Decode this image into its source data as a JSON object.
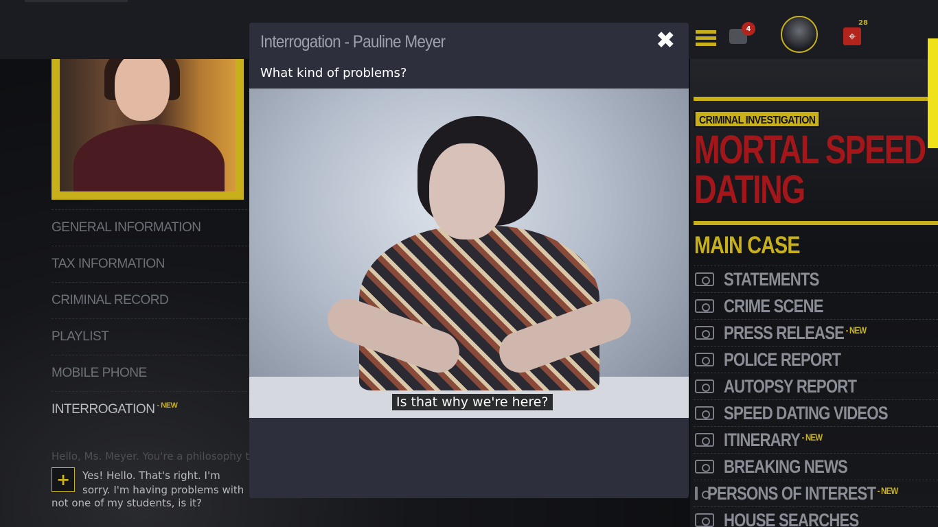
{
  "profile_menu": [
    {
      "label": "GENERAL INFORMATION",
      "new": ""
    },
    {
      "label": "TAX INFORMATION",
      "new": ""
    },
    {
      "label": "CRIMINAL RECORD",
      "new": ""
    },
    {
      "label": "PLAYLIST",
      "new": ""
    },
    {
      "label": "MOBILE PHONE",
      "new": ""
    },
    {
      "label": "INTERROGATION",
      "new": "- NEW"
    }
  ],
  "chat": {
    "intro": "Hello, Ms. Meyer. You're a philosophy tea",
    "plus": "+",
    "answer": "Yes! Hello. That's right. I'm sorry. I'm having problems with some parents so... It's",
    "answer_tail": "not one of my students, is it?"
  },
  "modal": {
    "title": "Interrogation - Pauline Meyer",
    "close": "✖",
    "question": "What kind of problems?",
    "subtitle": "Is that why we're here?"
  },
  "header": {
    "chat_count": "4",
    "target_count": "28",
    "target_icon": "⌖"
  },
  "case": {
    "tag": "CRIMINAL INVESTIGATION",
    "title": "MORTAL SPEED DATING",
    "section": "MAIN CASE",
    "items": [
      {
        "label": "STATEMENTS",
        "new": ""
      },
      {
        "label": "CRIME SCENE",
        "new": ""
      },
      {
        "label": "PRESS RELEASE",
        "new": "- NEW"
      },
      {
        "label": "POLICE REPORT",
        "new": ""
      },
      {
        "label": "AUTOPSY REPORT",
        "new": ""
      },
      {
        "label": "SPEED DATING VIDEOS",
        "new": ""
      },
      {
        "label": "ITINERARY",
        "new": "- NEW"
      },
      {
        "label": "BREAKING NEWS",
        "new": ""
      },
      {
        "label": "PERSONS OF INTEREST",
        "new": "- NEW"
      },
      {
        "label": "HOUSE SEARCHES",
        "new": ""
      }
    ]
  },
  "colors": {
    "accent": "#c7b01a",
    "danger": "#a3171a",
    "modal_bg": "#2d303c"
  }
}
